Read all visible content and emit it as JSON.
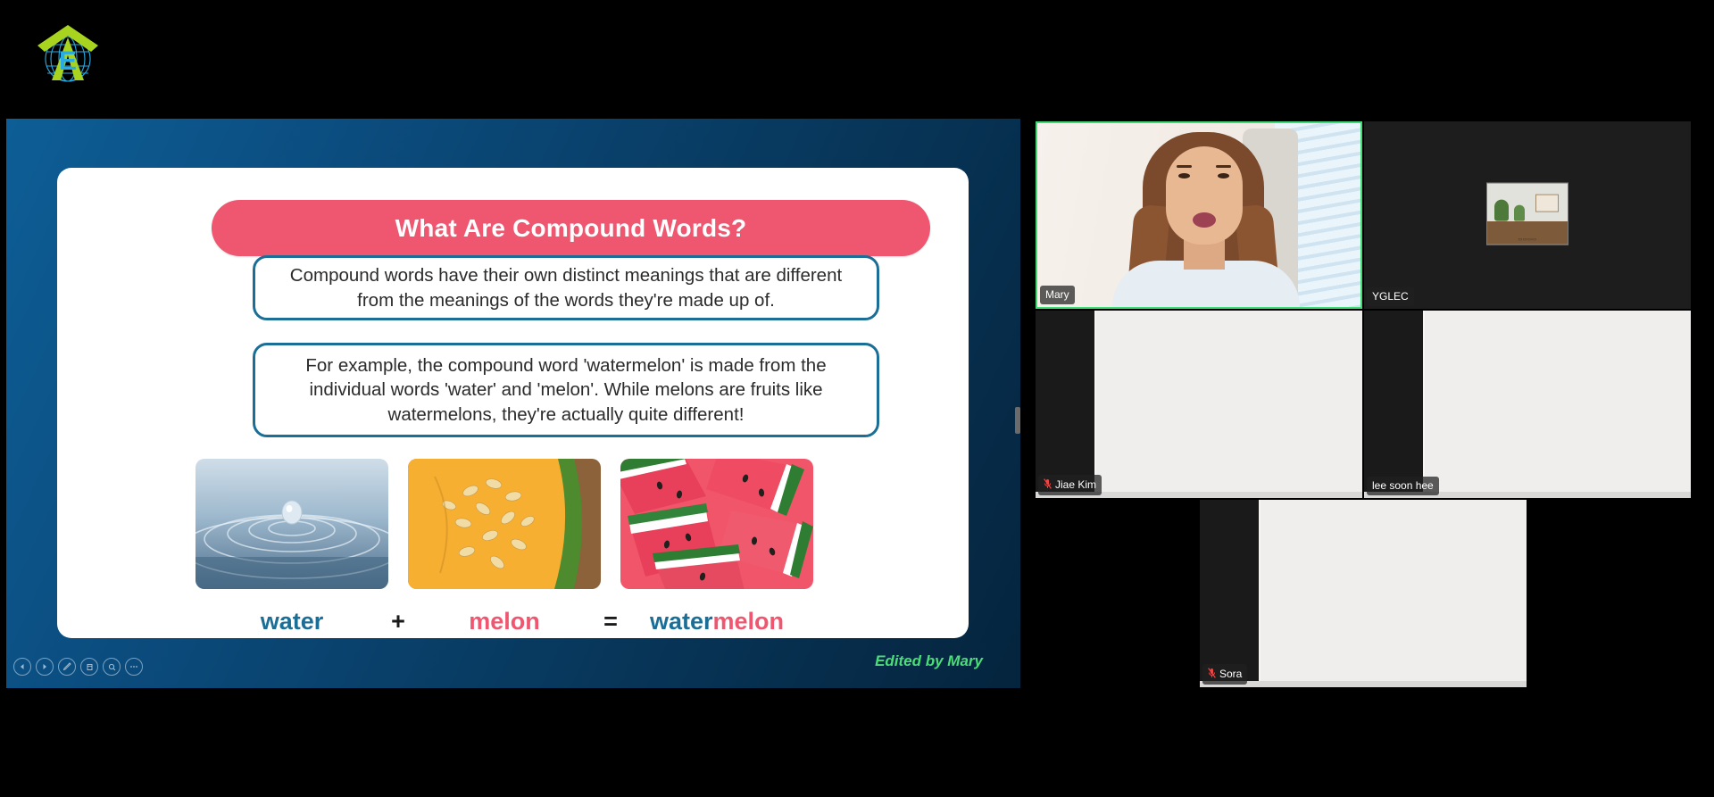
{
  "meeting": {
    "logo_alt": "yglec-globe-logo",
    "split_handle": "share-resize-handle"
  },
  "slide": {
    "title": "What Are Compound Words?",
    "boxes": [
      "Compound words have their own distinct meanings that are different from the meanings of the words they're made up of.",
      "For example, the compound word 'watermelon' is made from the individual words 'water' and 'melon'. While melons are fruits like watermelons, they're actually quite different!"
    ],
    "images": [
      {
        "name": "water-droplet-image",
        "caption": "water"
      },
      {
        "name": "melon-slice-image",
        "caption": "melon"
      },
      {
        "name": "watermelon-slices-image",
        "caption": "watermelon"
      }
    ],
    "equation": {
      "left": "water",
      "plus": "+",
      "middle": "melon",
      "equals": "=",
      "result_prefix": "water",
      "result_suffix": "melon"
    },
    "credit": "Edited by Mary",
    "colors": {
      "title_band": "#ef566f",
      "box_border": "#1b6f96",
      "water": "#1b6f96",
      "melon": "#ef566f",
      "credit": "#4ddc7a",
      "active_speaker": "#3ddc74"
    }
  },
  "toolbar": {
    "buttons": [
      {
        "name": "previous-slide-button",
        "glyph": "◀"
      },
      {
        "name": "next-slide-button",
        "glyph": "▶"
      },
      {
        "name": "annotate-pen-button",
        "glyph": "╱"
      },
      {
        "name": "slide-notes-button",
        "glyph": "☰"
      },
      {
        "name": "zoom-search-button",
        "glyph": "⚲"
      },
      {
        "name": "more-options-button",
        "glyph": "…"
      }
    ]
  },
  "gallery": {
    "tiles": [
      {
        "id": "mary",
        "name": "Mary",
        "muted": false,
        "active_speaker": true,
        "video_on": true
      },
      {
        "id": "yglec",
        "name": "YGLEC",
        "muted": false,
        "active_speaker": false,
        "video_on": true
      },
      {
        "id": "jiae",
        "name": "Jiae Kim",
        "muted": true,
        "active_speaker": false,
        "video_on": true
      },
      {
        "id": "lee",
        "name": "lee soon hee",
        "muted": false,
        "active_speaker": false,
        "video_on": true
      },
      {
        "id": "sora",
        "name": "Sora",
        "muted": true,
        "active_speaker": false,
        "video_on": true
      }
    ],
    "mute_glyph": "🎙"
  }
}
